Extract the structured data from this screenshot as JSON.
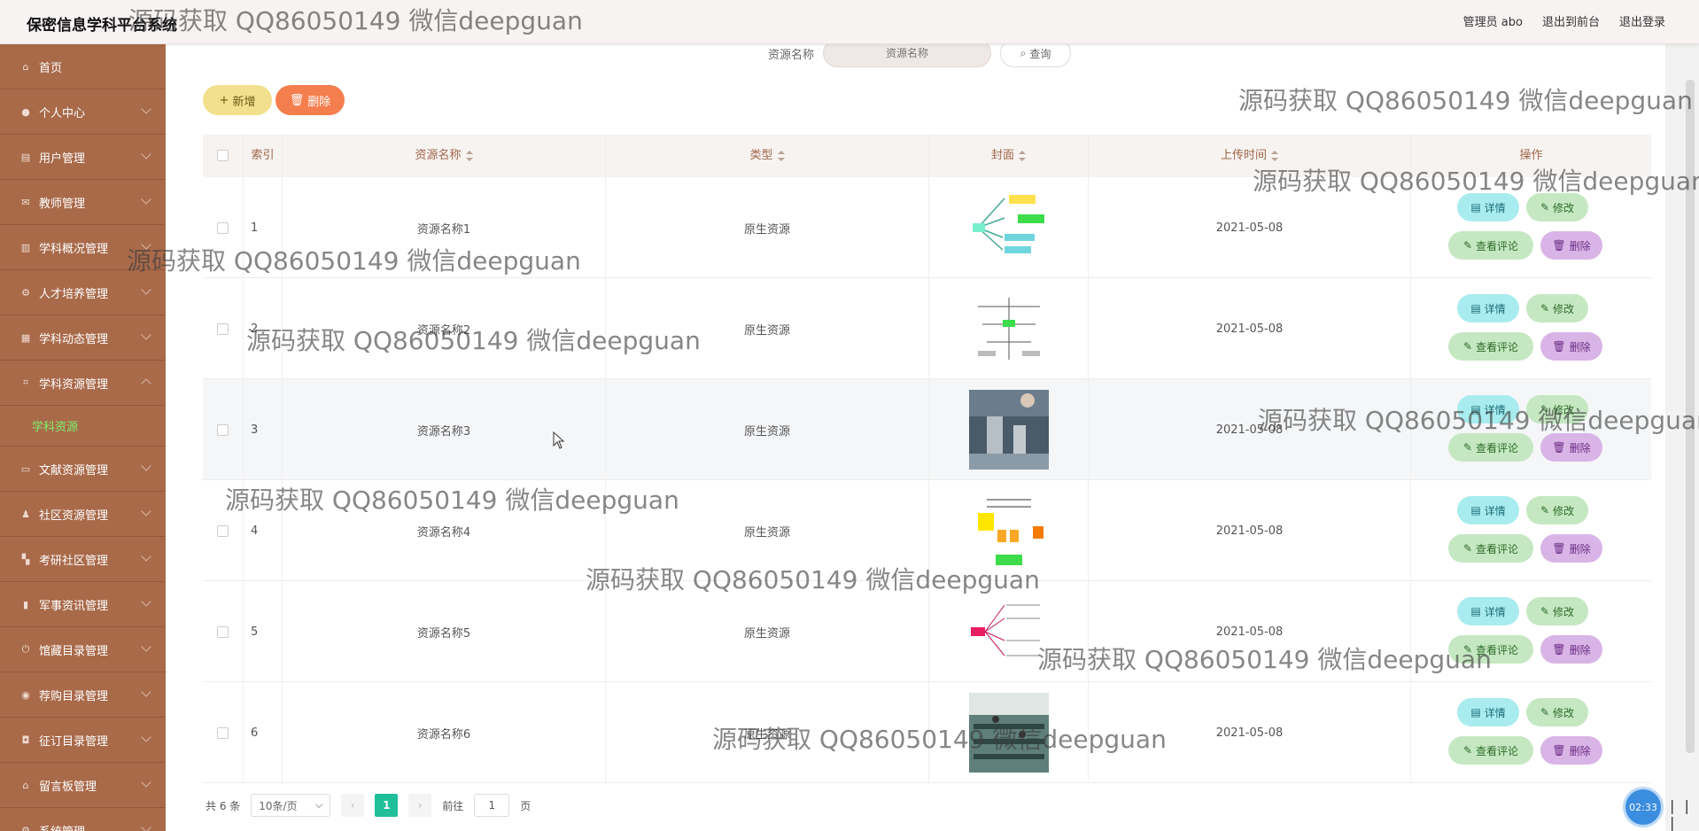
{
  "app": {
    "title": "保密信息学科平台系统",
    "user_label": "管理员 abo",
    "front_label": "退出到前台",
    "logout_label": "退出登录"
  },
  "sidebar": {
    "items": [
      {
        "label": "首页",
        "icon": "home-icon"
      },
      {
        "label": "个人中心",
        "icon": "user-icon"
      },
      {
        "label": "用户管理",
        "icon": "doc-icon"
      },
      {
        "label": "教师管理",
        "icon": "mail-icon"
      },
      {
        "label": "学科概况管理",
        "icon": "chart-icon"
      },
      {
        "label": "人才培养管理",
        "icon": "gear-icon"
      },
      {
        "label": "学科动态管理",
        "icon": "grid-icon"
      },
      {
        "label": "学科资源管理",
        "icon": "crop-icon"
      },
      {
        "label": "文献资源管理",
        "icon": "ticket-icon"
      },
      {
        "label": "社区资源管理",
        "icon": "person-icon"
      },
      {
        "label": "考研社区管理",
        "icon": "apps-icon"
      },
      {
        "label": "军事资讯管理",
        "icon": "bar-icon"
      },
      {
        "label": "馆藏目录管理",
        "icon": "power-icon"
      },
      {
        "label": "荐购目录管理",
        "icon": "pin-icon"
      },
      {
        "label": "征订目录管理",
        "icon": "lock-icon"
      },
      {
        "label": "留言板管理",
        "icon": "bank-icon"
      },
      {
        "label": "系统管理",
        "icon": "cog-icon"
      }
    ],
    "sub_item": "学科资源"
  },
  "search": {
    "label": "资源名称",
    "placeholder": "资源名称",
    "query_label": "查询"
  },
  "actions": {
    "add_label": "新增",
    "delete_label": "删除"
  },
  "table": {
    "headers": {
      "index": "索引",
      "name": "资源名称",
      "type": "类型",
      "cover": "封面",
      "upload_time": "上传时间",
      "ops": "操作"
    },
    "rows": [
      {
        "index": "1",
        "name": "资源名称1",
        "type": "原生资源",
        "date": "2021-05-08",
        "cover": "mindmap"
      },
      {
        "index": "2",
        "name": "资源名称2",
        "type": "原生资源",
        "date": "2021-05-08",
        "cover": "diagram"
      },
      {
        "index": "3",
        "name": "资源名称3",
        "type": "原生资源",
        "date": "2021-05-08",
        "cover": "lab-photo"
      },
      {
        "index": "4",
        "name": "资源名称4",
        "type": "原生资源",
        "date": "2021-05-08",
        "cover": "flowchart"
      },
      {
        "index": "5",
        "name": "资源名称5",
        "type": "原生资源",
        "date": "2021-05-08",
        "cover": "mindmap2"
      },
      {
        "index": "6",
        "name": "资源名称6",
        "type": "原生资源",
        "date": "2021-05-08",
        "cover": "classroom-photo"
      }
    ],
    "op_labels": {
      "detail": "详情",
      "edit": "修改",
      "comment": "查看评论",
      "delete": "删除"
    }
  },
  "pagination": {
    "total": "共 6 条",
    "page_size": "10条/页",
    "current_page": "1",
    "goto_prefix": "前往",
    "goto_value": "1",
    "goto_suffix": "页"
  },
  "watermark_text": "源码获取 QQ86050149 微信deepguan",
  "recorder": {
    "time": "02:33",
    "pause": "| | |"
  },
  "colors": {
    "sidebar": "#a96a4a",
    "sub_active": "#7cf26b",
    "header_text": "#a0664a",
    "page_active": "#1fbf9a",
    "add_btn": "#f3e08e",
    "del_btn": "#f57e4f"
  }
}
